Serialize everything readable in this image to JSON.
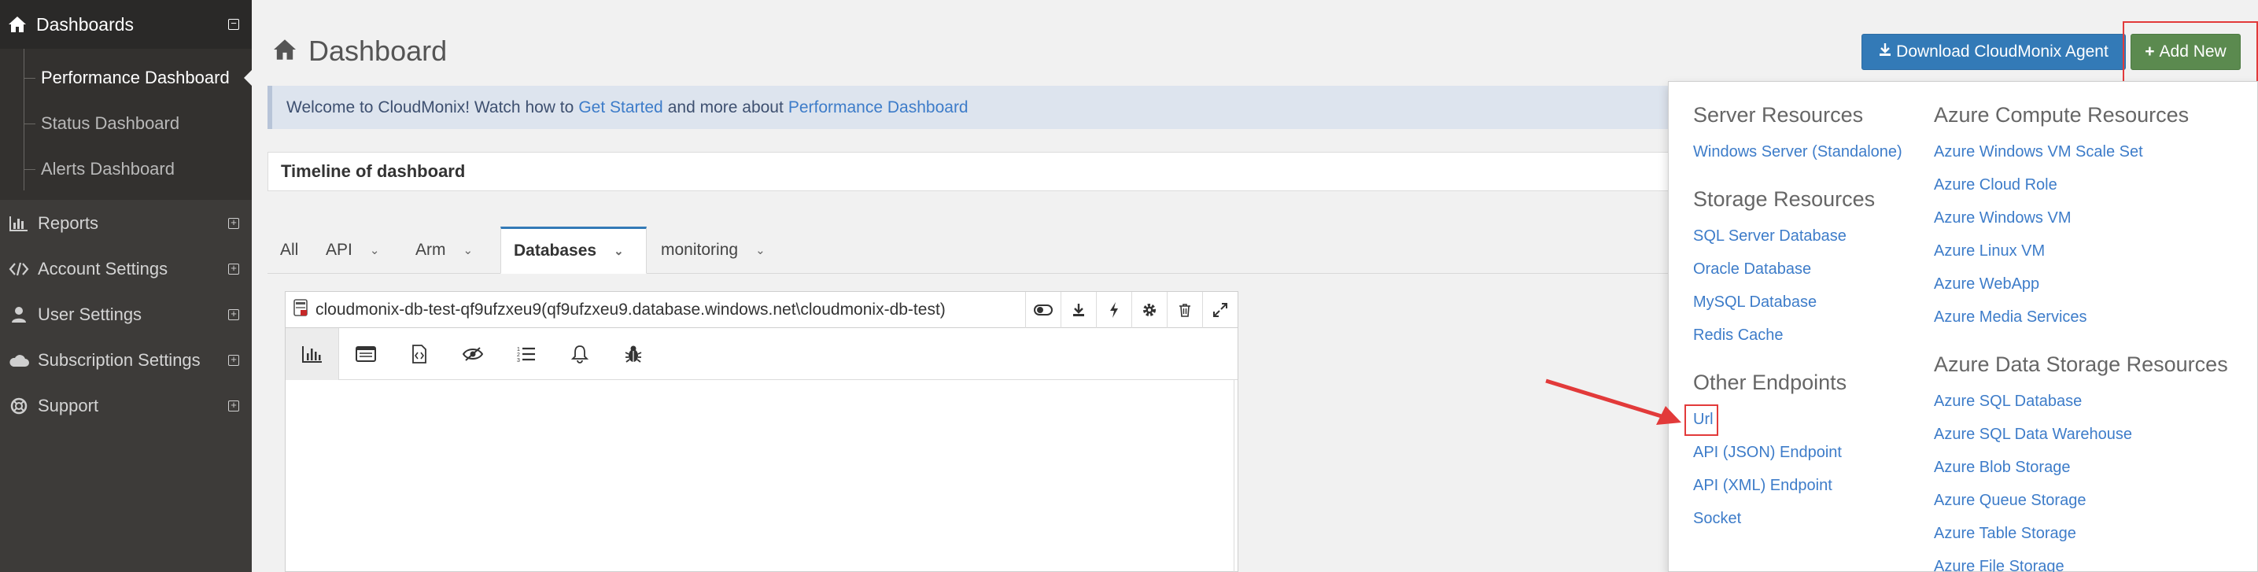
{
  "sidebar": {
    "header": "Dashboards",
    "sub_items": [
      "Performance Dashboard",
      "Status Dashboard",
      "Alerts Dashboard"
    ],
    "items": [
      "Reports",
      "Account Settings",
      "User Settings",
      "Subscription Settings",
      "Support"
    ]
  },
  "main": {
    "title": "Dashboard",
    "download_button": "Download CloudMonix Agent",
    "add_button": "Add New",
    "welcome": {
      "prefix": "Welcome to CloudMonix! Watch how to",
      "link1": "Get Started",
      "middle": "and more about",
      "link2": "Performance Dashboard"
    },
    "timeline_title": "Timeline of dashboard",
    "tabs": [
      "All",
      "API",
      "Arm",
      "Databases",
      "monitoring"
    ],
    "active_tab": "Databases",
    "panel_title": "cloudmonix-db-test-qf9ufzxeu9(qf9ufzxeu9.database.windows.net\\cloudmonix-db-test)"
  },
  "dropdown": {
    "server": {
      "heading": "Server Resources",
      "items": [
        "Windows Server (Standalone)"
      ]
    },
    "storage": {
      "heading": "Storage Resources",
      "items": [
        "SQL Server Database",
        "Oracle Database",
        "MySQL Database",
        "Redis Cache"
      ]
    },
    "other": {
      "heading": "Other Endpoints",
      "items": [
        "Url",
        "API (JSON) Endpoint",
        "API (XML) Endpoint",
        "Socket"
      ]
    },
    "azure_compute": {
      "heading": "Azure Compute Resources",
      "items": [
        "Azure Windows VM Scale Set",
        "Azure Cloud Role",
        "Azure Windows VM",
        "Azure Linux VM",
        "Azure WebApp",
        "Azure Media Services"
      ]
    },
    "azure_data": {
      "heading": "Azure Data Storage Resources",
      "items": [
        "Azure SQL Database",
        "Azure SQL Data Warehouse",
        "Azure Blob Storage",
        "Azure Queue Storage",
        "Azure Table Storage",
        "Azure File Storage"
      ]
    }
  },
  "colors": {
    "accent_blue": "#337ab7",
    "green": "#5b8a4f",
    "highlight_red": "#e23a3a",
    "sidebar_bg": "#3d3b39"
  },
  "icons": [
    "home-icon",
    "bar-chart-icon",
    "code-icon",
    "user-icon",
    "cloud-icon",
    "lifebuoy-icon",
    "download-icon",
    "plus-icon",
    "database-icon"
  ]
}
